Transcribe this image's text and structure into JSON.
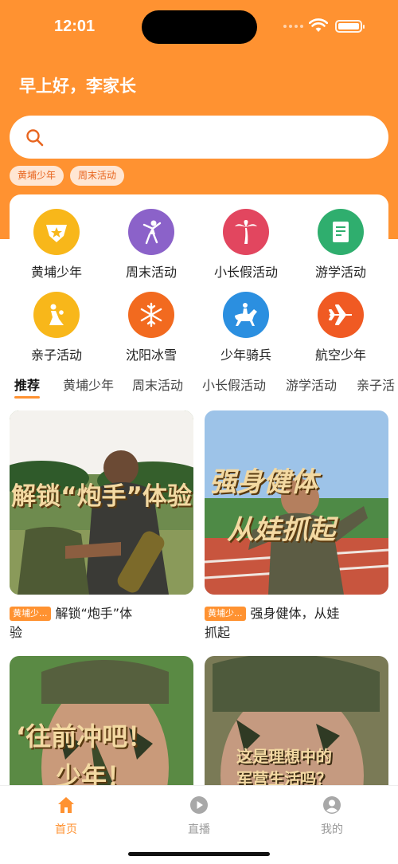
{
  "status": {
    "time": "12:01"
  },
  "greeting": "早上好，李家长",
  "search": {
    "placeholder": ""
  },
  "chips": [
    "黄埔少年",
    "周末活动"
  ],
  "categories": [
    {
      "label": "黄埔少年",
      "icon": "star-badge-icon",
      "color": "#F8B71A"
    },
    {
      "label": "周末活动",
      "icon": "dancing-girl-icon",
      "color": "#8B62C9"
    },
    {
      "label": "小长假活动",
      "icon": "palm-tree-icon",
      "color": "#E2465F"
    },
    {
      "label": "游学活动",
      "icon": "certificate-icon",
      "color": "#2FAE6E"
    },
    {
      "label": "亲子活动",
      "icon": "parent-child-icon",
      "color": "#F8B71A"
    },
    {
      "label": "沈阳冰雪",
      "icon": "snowflake-icon",
      "color": "#F26A1F"
    },
    {
      "label": "少年骑兵",
      "icon": "horse-rider-icon",
      "color": "#2B8FE0"
    },
    {
      "label": "航空少年",
      "icon": "airplane-icon",
      "color": "#F05A23"
    }
  ],
  "tabs": [
    "推荐",
    "黄埔少年",
    "周末活动",
    "小长假活动",
    "游学活动",
    "亲子活"
  ],
  "feed": [
    {
      "badge": "黄埔少...",
      "title_line1": "解锁“炮手”体",
      "title_line2": "验",
      "overlay": "解锁“炮手”体验"
    },
    {
      "badge": "黄埔少...",
      "title_line1": "强身健体，从娃",
      "title_line2": "抓起",
      "overlay1": "强身健体",
      "overlay2": "从娃抓起"
    },
    {
      "overlay1": "‘往前冲吧！",
      "overlay2": "少年！"
    },
    {
      "overlay1": "这是理想中的",
      "overlay2": "军营生活吗？"
    }
  ],
  "tabbar": [
    {
      "label": "首页",
      "icon": "home-icon",
      "active": true
    },
    {
      "label": "直播",
      "icon": "play-icon",
      "active": false
    },
    {
      "label": "我的",
      "icon": "profile-icon",
      "active": false
    }
  ],
  "colors": {
    "brand": "#FF9231",
    "badge_text": "#E8651F"
  }
}
